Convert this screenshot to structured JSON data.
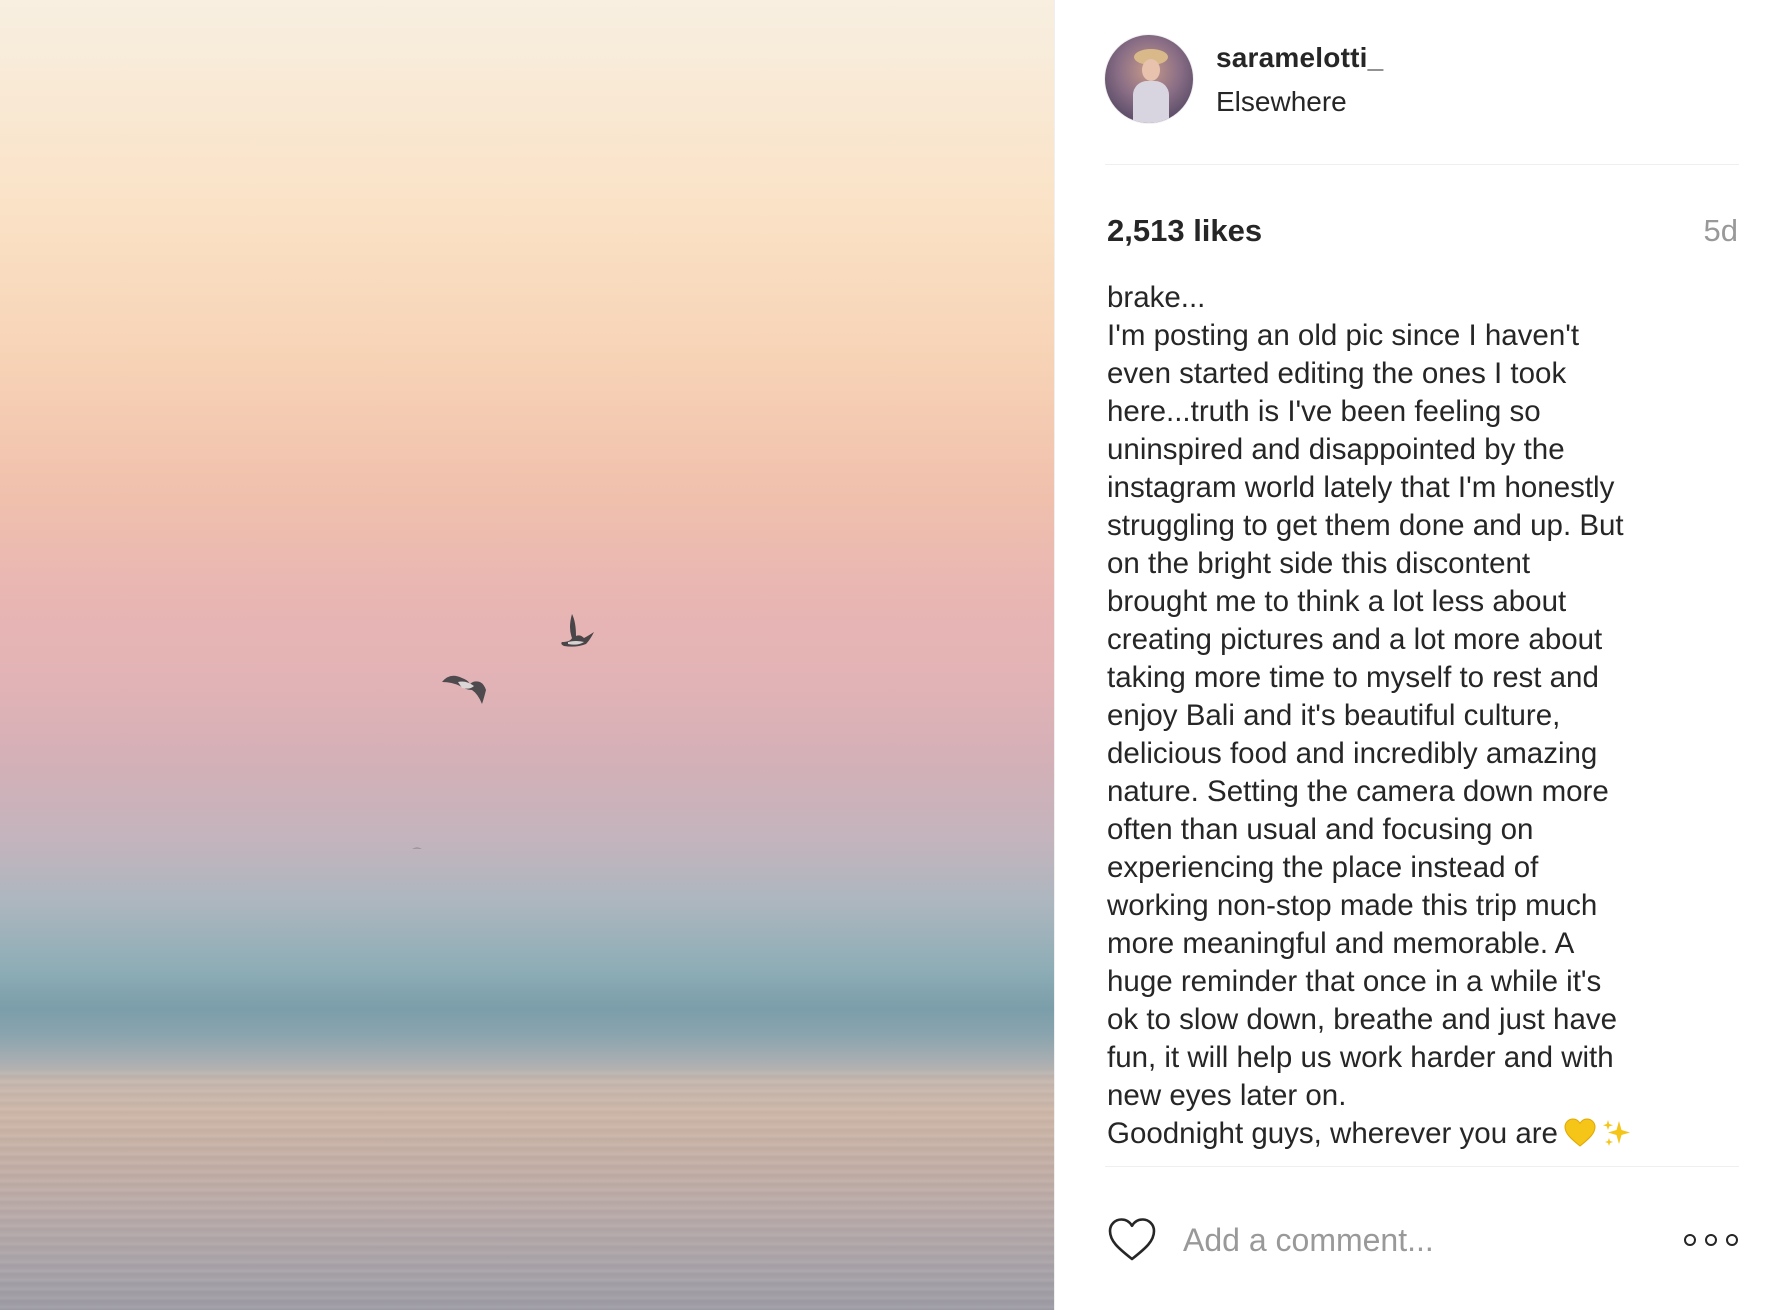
{
  "post": {
    "username": "saramelotti_",
    "location": "Elsewhere",
    "likes": "2,513 likes",
    "age": "5d",
    "caption_lines": [
      "brake...",
      "I'm posting an old pic since I haven't",
      "even started editing the ones I took",
      "here...truth is I've been feeling so",
      "uninspired and disappointed by the",
      "instagram world lately that I'm honestly",
      "struggling to get them done and up. But",
      "on the bright side this discontent",
      "brought me to think a lot less about",
      "creating pictures and a lot more about",
      "taking more time to myself to rest and",
      "enjoy Bali and it's beautiful culture,",
      "delicious food and incredibly amazing",
      "nature. Setting the camera down more",
      "often than usual and focusing on",
      "experiencing the place instead of",
      "working non-stop made this trip much",
      "more meaningful and memorable. A",
      "huge reminder that once in a while it's",
      "ok to slow down, breathe and just have",
      "fun, it will help us work harder and with",
      "new eyes later on.",
      "Goodnight guys, wherever you are"
    ],
    "caption_emoji": [
      "yellow-heart",
      "sparkles"
    ]
  },
  "comment_box": {
    "placeholder": "Add a comment..."
  },
  "icons": {
    "like": "heart-outline-icon",
    "more": "more-options-icon"
  },
  "colors": {
    "text": "#262626",
    "muted": "#999999",
    "divider": "#efefef"
  }
}
